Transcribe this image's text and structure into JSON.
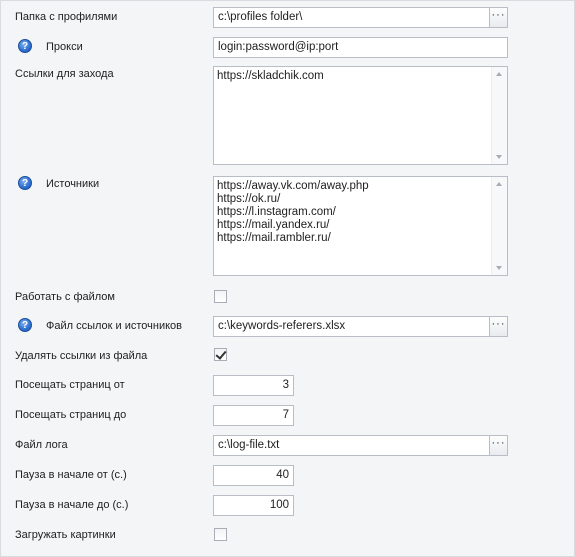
{
  "fields": {
    "profiles_folder": {
      "label": "Папка с профилями",
      "value": "c:\\profiles folder\\",
      "browse": "···"
    },
    "proxy": {
      "label": "Прокси",
      "value": "login:password@ip:port",
      "help": "?"
    },
    "entry_links": {
      "label": "Ссылки для захода",
      "lines": [
        "https://skladchik.com"
      ]
    },
    "sources": {
      "label": "Источники",
      "help": "?",
      "lines": [
        "https://away.vk.com/away.php",
        "https://ok.ru/",
        "https://l.instagram.com/",
        "https://mail.yandex.ru/",
        "https://mail.rambler.ru/"
      ]
    },
    "work_with_file": {
      "label": "Работать с файлом",
      "checked": false
    },
    "links_file": {
      "label": "Файл ссылок и источников",
      "help": "?",
      "value": "c:\\keywords-referers.xlsx",
      "browse": "···"
    },
    "delete_links": {
      "label": "Удалять ссылки из файла",
      "checked": true
    },
    "pages_from": {
      "label": "Посещать страниц от",
      "value": "3"
    },
    "pages_to": {
      "label": "Посещать страниц до",
      "value": "7"
    },
    "log_file": {
      "label": "Файл лога",
      "value": "c:\\log-file.txt",
      "browse": "···"
    },
    "pause_start_from": {
      "label": "Пауза в начале от (с.)",
      "value": "40"
    },
    "pause_start_to": {
      "label": "Пауза в начале до (с.)",
      "value": "100"
    },
    "load_images": {
      "label": "Загружать картинки",
      "checked": false
    }
  }
}
